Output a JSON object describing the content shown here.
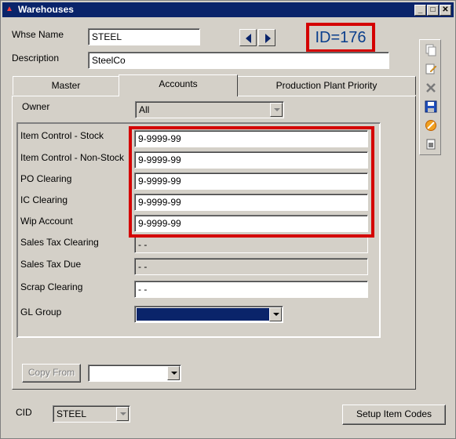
{
  "window": {
    "title": "Warehouses",
    "controls": {
      "minimize": "_",
      "maximize": "□",
      "close": "✕"
    }
  },
  "header": {
    "whse_name_label": "Whse Name",
    "whse_name_value": "STEEL",
    "description_label": "Description",
    "description_value": "SteelCo",
    "id_text": "ID=176"
  },
  "tabs": [
    {
      "label": "Master"
    },
    {
      "label": "Accounts"
    },
    {
      "label": "Production Plant Priority"
    }
  ],
  "accounts": {
    "owner_label": "Owner",
    "owner_value": "All",
    "rows": [
      {
        "label": "Item Control - Stock",
        "value": "9-9999-99"
      },
      {
        "label": "Item Control - Non-Stock",
        "value": "9-9999-99"
      },
      {
        "label": "PO Clearing",
        "value": "9-9999-99"
      },
      {
        "label": "IC Clearing",
        "value": "9-9999-99"
      },
      {
        "label": "Wip Account",
        "value": "9-9999-99"
      },
      {
        "label": "Sales Tax Clearing",
        "value": "-   -"
      },
      {
        "label": "Sales Tax Due",
        "value": "-   -"
      },
      {
        "label": "Scrap Clearing",
        "value": "-   -"
      }
    ],
    "gl_group_label": "GL Group",
    "gl_group_value": "",
    "copy_from_label": "Copy From",
    "copy_from_value": ""
  },
  "footer": {
    "cid_label": "CID",
    "cid_value": "STEEL",
    "setup_button": "Setup Item Codes"
  },
  "toolbar_icons": [
    "copy-icon",
    "edit-icon",
    "delete-icon",
    "save-icon",
    "cancel-icon",
    "print-icon"
  ],
  "colors": {
    "titlebar": "#0a246a",
    "highlight": "#d40000",
    "id_text": "#0a3e8c",
    "gl_selected": "#0a246a"
  }
}
